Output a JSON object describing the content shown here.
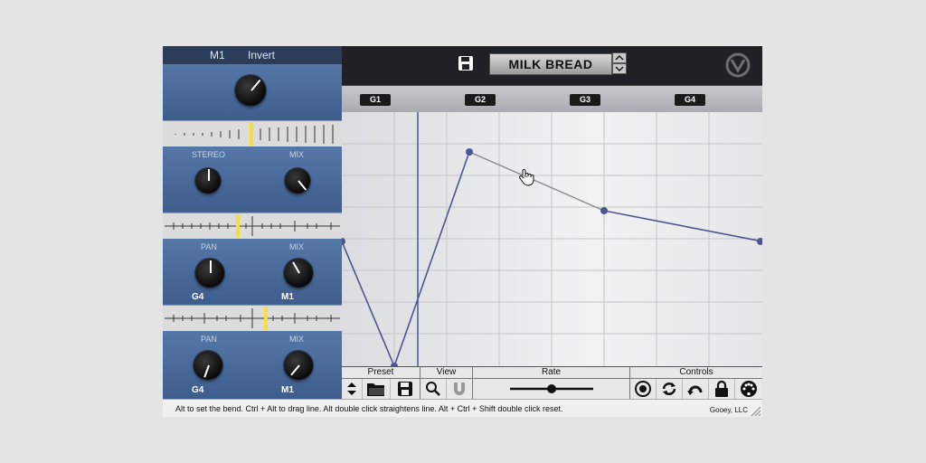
{
  "left_panel": {
    "header": {
      "slot": "M1",
      "mode": "Invert"
    },
    "section2": {
      "knob1_label": "STEREO",
      "knob2_label": "MIX"
    },
    "section3": {
      "knob1_label": "PAN",
      "knob2_label": "MIX",
      "knob1_dest": "G4",
      "knob2_dest": "M1"
    },
    "section4": {
      "knob1_label": "PAN",
      "knob2_label": "MIX",
      "knob1_dest": "G4",
      "knob2_dest": "M1"
    }
  },
  "topbar": {
    "preset_name": "MILK BREAD"
  },
  "groups": [
    "G1",
    "G2",
    "G3",
    "G4"
  ],
  "controls": {
    "preset_label": "Preset",
    "view_label": "View",
    "rate_label": "Rate",
    "controls_label": "Controls",
    "rate_value": 0.5
  },
  "status": {
    "message": "Alt to set the bend. Ctrl + Alt to drag line. Alt double click straightens line. Alt + Ctrl + Shift double click reset.",
    "company": "Gooey, LLC"
  },
  "colors": {
    "panel_blue": "#4a6a99",
    "marker_yellow": "#f2e13a",
    "curve": "#4c5591"
  }
}
